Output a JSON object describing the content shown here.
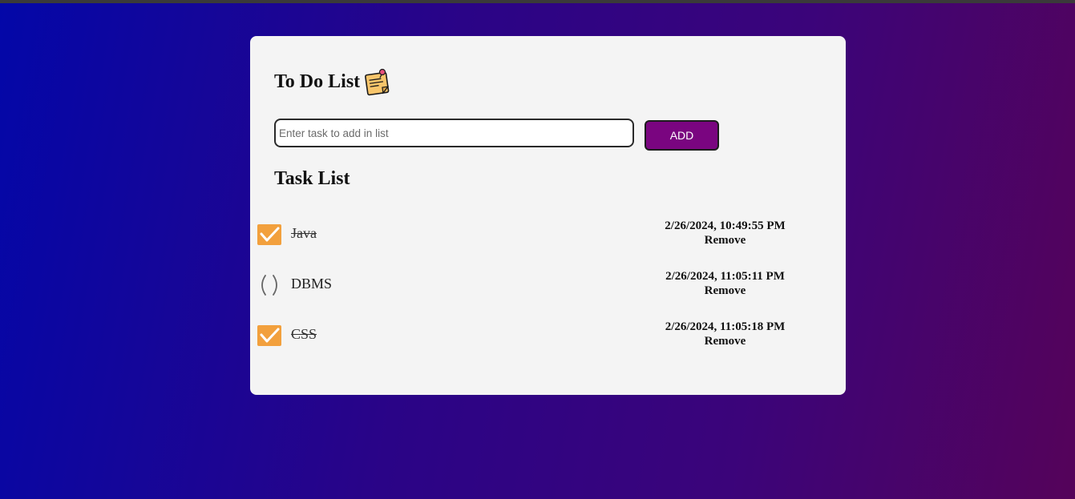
{
  "header": {
    "title": "To Do List",
    "icon": "sticky-note-icon"
  },
  "input": {
    "placeholder": "Enter task to add in list",
    "value": ""
  },
  "add_button": {
    "label": "ADD"
  },
  "list_title": "Task List",
  "tasks": [
    {
      "text": "Java",
      "done": true,
      "timestamp": "2/26/2024, 10:49:55 PM",
      "remove_label": "Remove"
    },
    {
      "text": "DBMS",
      "done": false,
      "timestamp": "2/26/2024, 11:05:11 PM",
      "remove_label": "Remove"
    },
    {
      "text": "CSS",
      "done": true,
      "timestamp": "2/26/2024, 11:05:18 PM",
      "remove_label": "Remove"
    }
  ],
  "colors": {
    "accent": "#7a0580",
    "checkbox": "#f2a03d",
    "card": "#f4f4f4",
    "gradient_start": "#0307a8",
    "gradient_end": "#55035a"
  }
}
